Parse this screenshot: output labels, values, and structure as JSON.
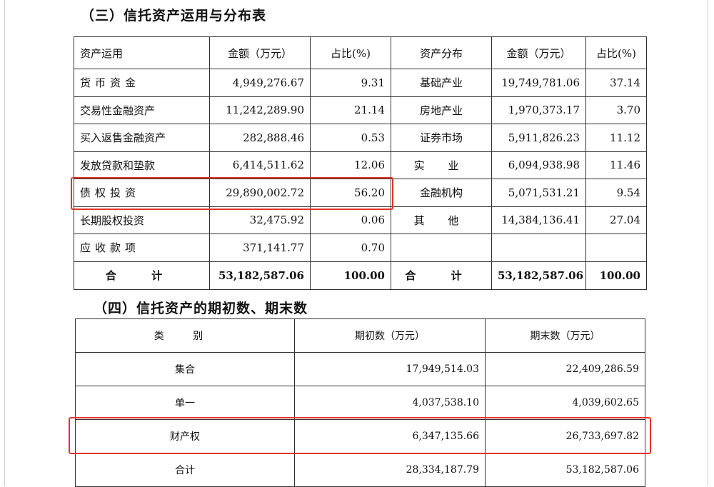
{
  "section3": {
    "title": "（三）信托资产运用与分布表",
    "headers": [
      "资产运用",
      "金额（万元）",
      "占比(%)",
      "资产分布",
      "金额（万元）",
      "占比(%)"
    ],
    "rows": [
      {
        "use": "货币资金",
        "use_amount": "4,949,276.67",
        "use_pct": "9.31",
        "dist": "基础产业",
        "dist_amount": "19,749,781.06",
        "dist_pct": "37.14"
      },
      {
        "use": "交易性金融资产",
        "use_amount": "11,242,289.90",
        "use_pct": "21.14",
        "dist": "房地产业",
        "dist_amount": "1,970,373.17",
        "dist_pct": "3.70"
      },
      {
        "use": "买入返售金融资产",
        "use_amount": "282,888.46",
        "use_pct": "0.53",
        "dist": "证券市场",
        "dist_amount": "5,911,826.23",
        "dist_pct": "11.12"
      },
      {
        "use": "发放贷款和垫款",
        "use_amount": "6,414,511.62",
        "use_pct": "12.06",
        "dist": "实 业",
        "dist_amount": "6,094,938.98",
        "dist_pct": "11.46"
      },
      {
        "use": "债权投资",
        "use_amount": "29,890,002.72",
        "use_pct": "56.20",
        "dist": "金融机构",
        "dist_amount": "5,071,531.21",
        "dist_pct": "9.54"
      },
      {
        "use": "长期股权投资",
        "use_amount": "32,475.92",
        "use_pct": "0.06",
        "dist": "其 他",
        "dist_amount": "14,384,136.41",
        "dist_pct": "27.04"
      },
      {
        "use": "应收款项",
        "use_amount": "371,141.77",
        "use_pct": "0.70",
        "dist": "",
        "dist_amount": "",
        "dist_pct": ""
      }
    ],
    "total": {
      "use": "合 计",
      "use_amount": "53,182,587.06",
      "use_pct": "100.00",
      "dist": "合 计",
      "dist_amount": "53,182,587.06",
      "dist_pct": "100.00"
    }
  },
  "section4": {
    "title": "（四）信托资产的期初数、期末数",
    "headers": [
      "类 别",
      "期初数（万元）",
      "期末数（万元）"
    ],
    "rows": [
      {
        "category": "集合",
        "begin": "17,949,514.03",
        "end": "22,409,286.59"
      },
      {
        "category": "单一",
        "begin": "4,037,538.10",
        "end": "4,039,602.65"
      },
      {
        "category": "财产权",
        "begin": "6,347,135.66",
        "end": "26,733,697.82"
      },
      {
        "category": "合计",
        "begin": "28,334,187.79",
        "end": "53,182,587.06"
      }
    ]
  },
  "highlight_color": "#e0342b"
}
